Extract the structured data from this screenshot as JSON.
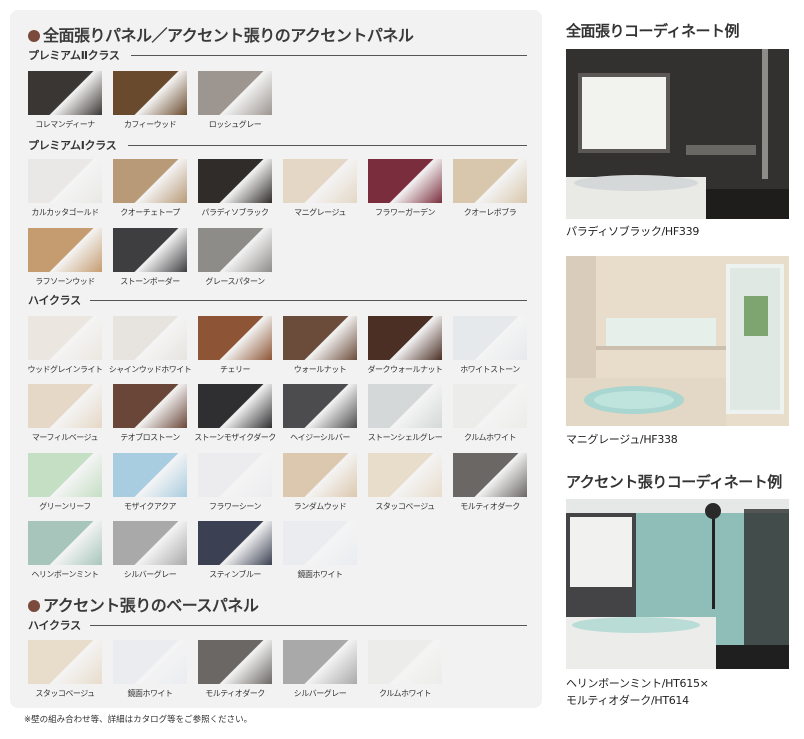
{
  "section1_heading": "全面張りパネル／アクセント張りのアクセントパネル",
  "section2_heading": "アクセント張りのベースパネル",
  "classes": {
    "premium2": "プレミアムⅡクラス",
    "premium1": "プレミアムⅠクラス",
    "high": "ハイクラス",
    "high_base": "ハイクラス"
  },
  "swatches": {
    "premium2": [
      {
        "name": "コレマンディーナ",
        "color": "#3a3633"
      },
      {
        "name": "カフィーウッド",
        "color": "#6a4a2c"
      },
      {
        "name": "ロッシュグレー",
        "color": "#9c9590"
      }
    ],
    "premium1": [
      {
        "name": "カルカッタゴールド",
        "color": "#e9e8e6"
      },
      {
        "name": "クオーチェトープ",
        "color": "#b89a78"
      },
      {
        "name": "パラディソブラック",
        "color": "#2f2c2a"
      },
      {
        "name": "マニグレージュ",
        "color": "#e4d7c6"
      },
      {
        "name": "フラワーガーデン",
        "color": "#7a2d3c"
      },
      {
        "name": "クオーレボブラ",
        "color": "#d8c7ac"
      },
      {
        "name": "ラフソーンウッド",
        "color": "#c59c70"
      },
      {
        "name": "ストーンボーダー",
        "color": "#3e3e41"
      },
      {
        "name": "グレースパターン",
        "color": "#8e8c88"
      }
    ],
    "high": [
      {
        "name": "ウッドグレインライト",
        "color": "#ebe7e0"
      },
      {
        "name": "シャインウッドホワイト",
        "color": "#e7e4df"
      },
      {
        "name": "チェリー",
        "color": "#8d5535"
      },
      {
        "name": "ウォールナット",
        "color": "#6b4b3a"
      },
      {
        "name": "ダークウォールナット",
        "color": "#4b2f25"
      },
      {
        "name": "ホワイトストーン",
        "color": "#e6e9ec"
      },
      {
        "name": "マーフィルベージュ",
        "color": "#e5d8c6"
      },
      {
        "name": "テオブロストーン",
        "color": "#6a4638"
      },
      {
        "name": "ストーンモザイクダーク",
        "color": "#2f2f31"
      },
      {
        "name": "ヘイジーシルバー",
        "color": "#4c4c4e"
      },
      {
        "name": "ストーンシェルグレー",
        "color": "#d5d8d8"
      },
      {
        "name": "クルムホワイト",
        "color": "#ececea"
      },
      {
        "name": "グリーンリーフ",
        "color": "#c4dfc4"
      },
      {
        "name": "モザイクアクア",
        "color": "#a9cde0"
      },
      {
        "name": "フラワーシーン",
        "color": "#ecebee"
      },
      {
        "name": "ランダムウッド",
        "color": "#dcc8ae"
      },
      {
        "name": "スタッコベージュ",
        "color": "#e8dccb"
      },
      {
        "name": "モルティオダーク",
        "color": "#6a6764"
      },
      {
        "name": "ヘリンボーンミント",
        "color": "#a7c5bb"
      },
      {
        "name": "シルバーグレー",
        "color": "#a9a9a9"
      },
      {
        "name": "スティンブルー",
        "color": "#3b4152"
      },
      {
        "name": "鏡面ホワイト",
        "color": "#eaecf0"
      }
    ],
    "high_base": [
      {
        "name": "スタッコベージュ",
        "color": "#e8dccb"
      },
      {
        "name": "鏡面ホワイト",
        "color": "#eaecf0"
      },
      {
        "name": "モルティオダーク",
        "color": "#6a6764"
      },
      {
        "name": "シルバーグレー",
        "color": "#a9a9a9"
      },
      {
        "name": "クルムホワイト",
        "color": "#ececea"
      }
    ]
  },
  "right": {
    "full_title": "全面張りコーディネート例",
    "accent_title": "アクセント張りコーディネート例",
    "photo1_caption": "パラディソブラック/HF339",
    "photo2_caption": "マニグレージュ/HF338",
    "photo3_caption_1": "ヘリンボーンミント/HT615×",
    "photo3_caption_2": "モルティオダーク/HT614"
  },
  "note": "※壁の組み合わせ等、詳細はカタログ等をご参照ください。"
}
